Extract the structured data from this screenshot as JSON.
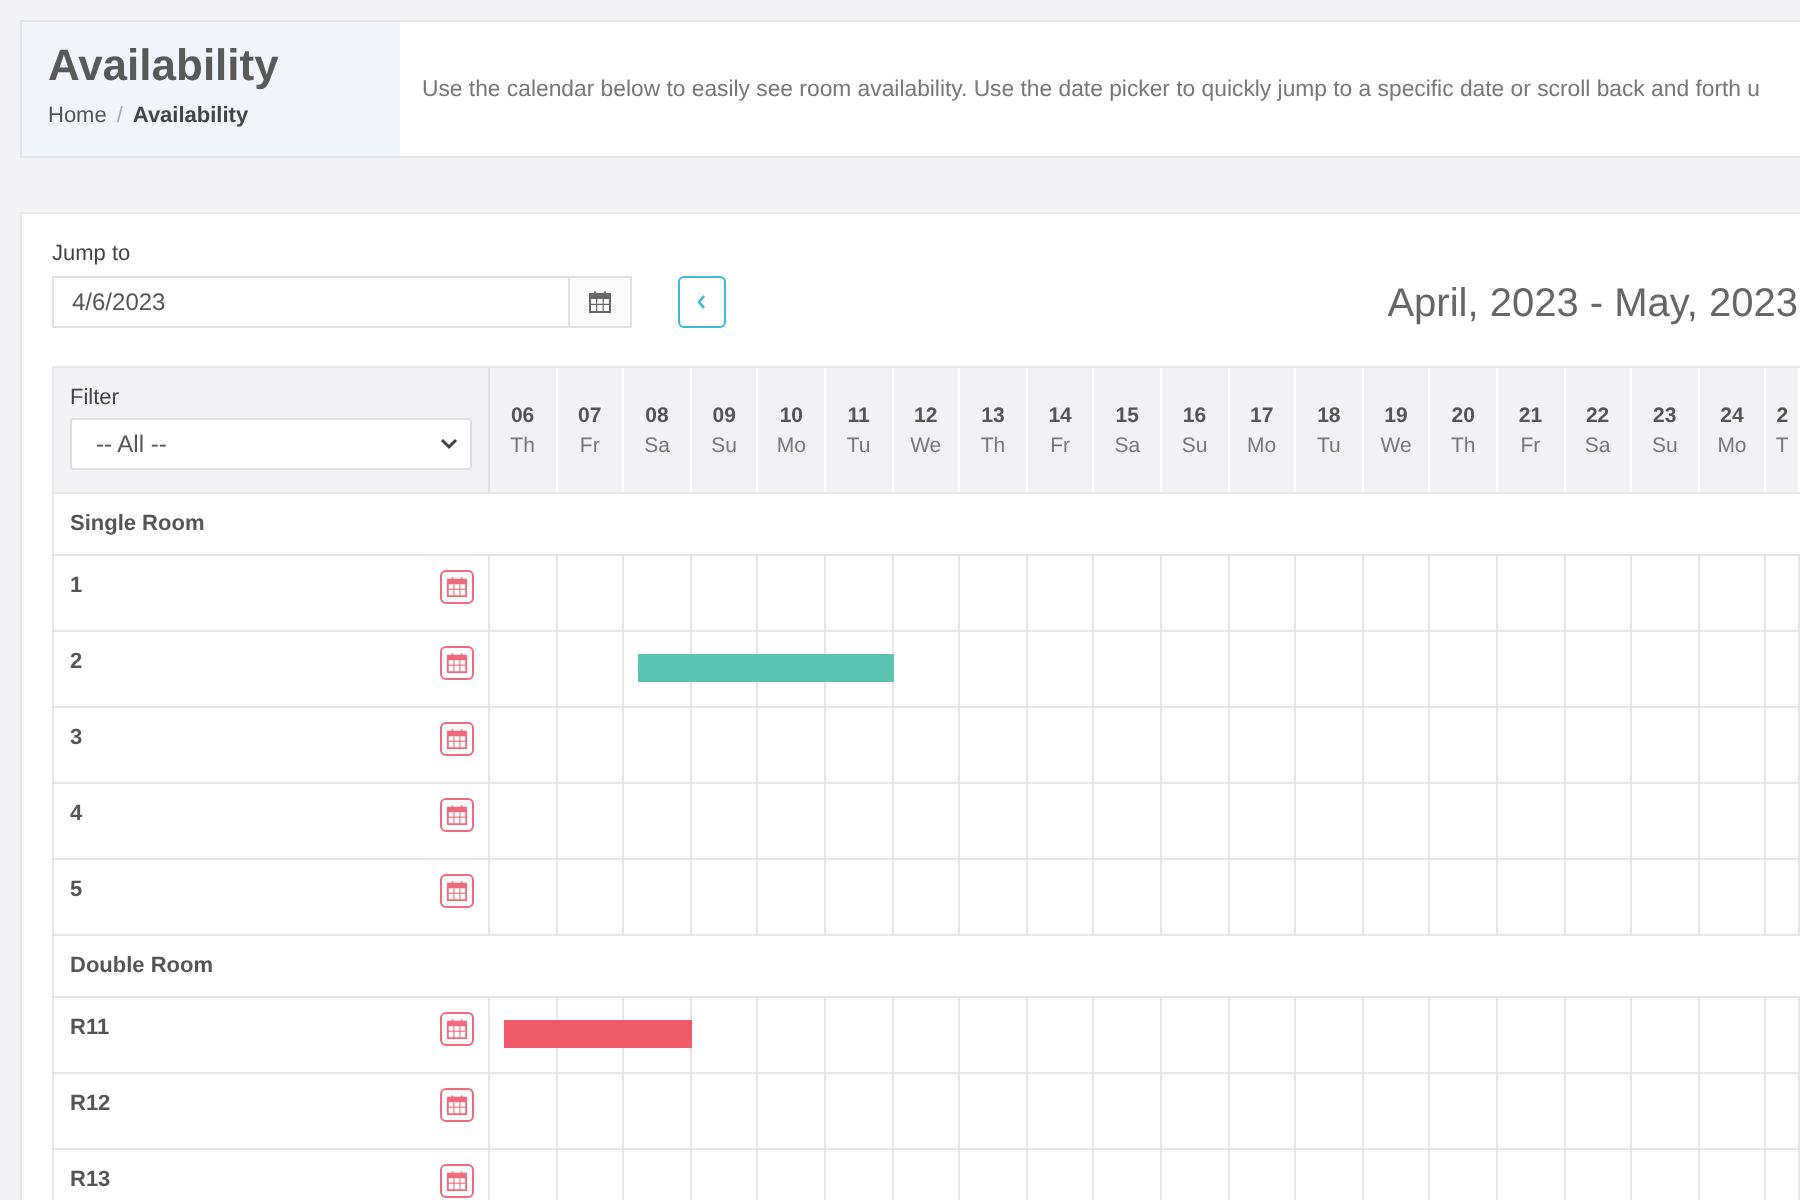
{
  "header": {
    "title": "Availability",
    "breadcrumb_separator": "/",
    "breadcrumb": [
      {
        "label": "Home",
        "selected": false
      },
      {
        "label": "Availability",
        "selected": true
      }
    ],
    "description": "Use the calendar below to easily see room availability. Use the date picker to quickly jump to a specific date or scroll back and forth u"
  },
  "jump_to": {
    "label": "Jump to",
    "value": "4/6/2023"
  },
  "range_title": "April, 2023 - May, 2023",
  "filter": {
    "label": "Filter",
    "value": "-- All --"
  },
  "days": [
    {
      "day": "06",
      "weekday": "Th"
    },
    {
      "day": "07",
      "weekday": "Fr"
    },
    {
      "day": "08",
      "weekday": "Sa"
    },
    {
      "day": "09",
      "weekday": "Su"
    },
    {
      "day": "10",
      "weekday": "Mo"
    },
    {
      "day": "11",
      "weekday": "Tu"
    },
    {
      "day": "12",
      "weekday": "We"
    },
    {
      "day": "13",
      "weekday": "Th"
    },
    {
      "day": "14",
      "weekday": "Fr"
    },
    {
      "day": "15",
      "weekday": "Sa"
    },
    {
      "day": "16",
      "weekday": "Su"
    },
    {
      "day": "17",
      "weekday": "Mo"
    },
    {
      "day": "18",
      "weekday": "Tu"
    },
    {
      "day": "19",
      "weekday": "We"
    },
    {
      "day": "20",
      "weekday": "Th"
    },
    {
      "day": "21",
      "weekday": "Fr"
    },
    {
      "day": "22",
      "weekday": "Sa"
    },
    {
      "day": "23",
      "weekday": "Su"
    },
    {
      "day": "24",
      "weekday": "Mo"
    },
    {
      "day": "2",
      "weekday": "T"
    }
  ],
  "groups": [
    {
      "name": "Single Room",
      "rooms": [
        {
          "name": "1"
        },
        {
          "name": "2",
          "booking": {
            "color": "#5bc4b1",
            "nights": [
              false,
              false,
              true,
              true,
              true,
              true,
              false,
              false,
              false,
              false,
              false,
              false,
              false,
              false,
              false,
              false,
              false,
              false,
              false,
              false
            ]
          }
        },
        {
          "name": "3"
        },
        {
          "name": "4"
        },
        {
          "name": "5"
        }
      ]
    },
    {
      "name": "Double Room",
      "rooms": [
        {
          "name": "R11",
          "booking": {
            "color": "#ef5a6b",
            "nights": [
              true,
              true,
              true,
              false,
              false,
              false,
              false,
              false,
              false,
              false,
              false,
              false,
              false,
              false,
              false,
              false,
              false,
              false,
              false,
              false
            ]
          }
        },
        {
          "name": "R12"
        },
        {
          "name": "R13"
        }
      ]
    }
  ]
}
